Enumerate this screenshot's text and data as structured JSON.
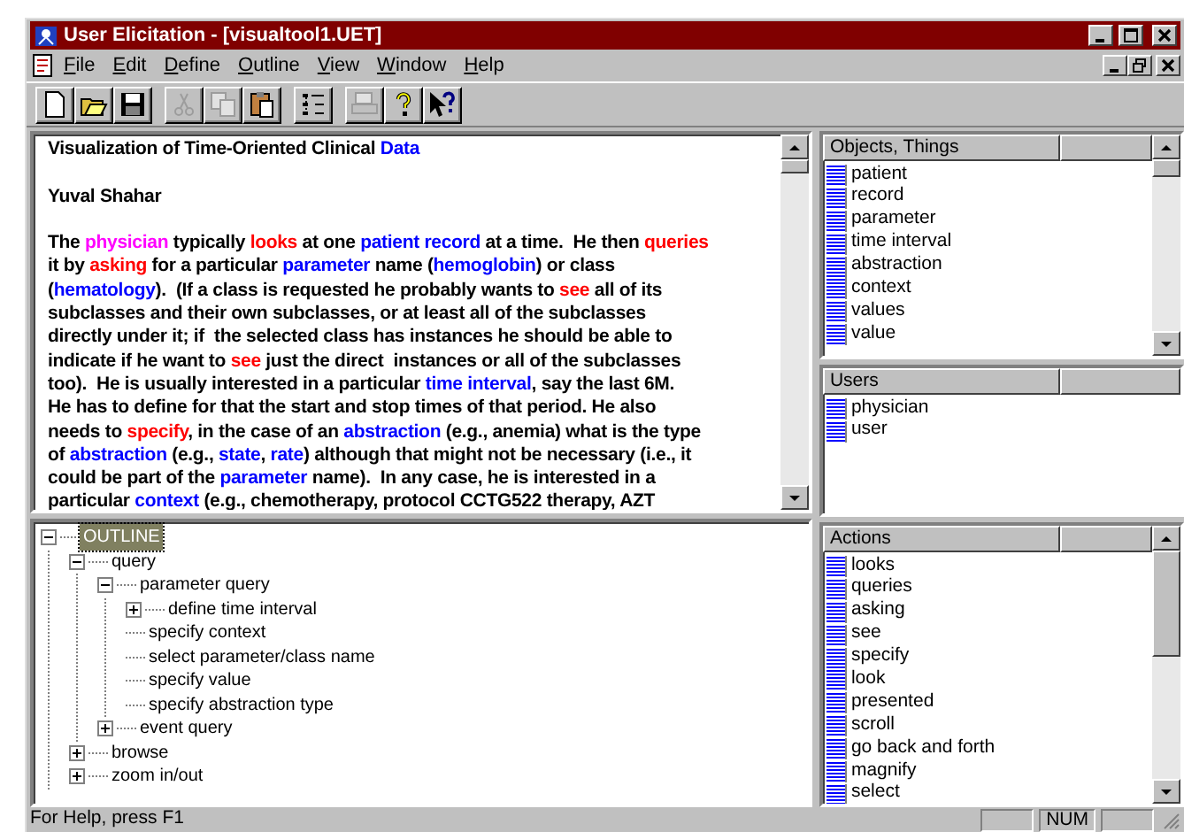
{
  "window": {
    "title": "User Elicitation - [visualtool1.UET]"
  },
  "menu": [
    "File",
    "Edit",
    "Define",
    "Outline",
    "View",
    "Window",
    "Help"
  ],
  "toolbar": [
    {
      "kind": "new",
      "disabled": false
    },
    {
      "kind": "open",
      "disabled": false
    },
    {
      "kind": "save",
      "disabled": false
    },
    {
      "kind": "sep"
    },
    {
      "kind": "cut",
      "disabled": true
    },
    {
      "kind": "copy",
      "disabled": true
    },
    {
      "kind": "paste",
      "disabled": false
    },
    {
      "kind": "sep"
    },
    {
      "kind": "outline",
      "disabled": false
    },
    {
      "kind": "sep"
    },
    {
      "kind": "print",
      "disabled": true
    },
    {
      "kind": "help",
      "disabled": false
    },
    {
      "kind": "context-help",
      "disabled": false
    }
  ],
  "document": {
    "title": [
      {
        "text": "Visualization of Time-Oriented Clinical ",
        "kind": "plain"
      },
      {
        "text": "Data",
        "kind": "object"
      }
    ],
    "author": "Yuval Shahar",
    "lines": [
      [
        {
          "text": "The ",
          "kind": "plain"
        },
        {
          "text": "physician",
          "kind": "user"
        },
        {
          "text": " typically ",
          "kind": "plain"
        },
        {
          "text": "looks",
          "kind": "action"
        },
        {
          "text": " at one ",
          "kind": "plain"
        },
        {
          "text": "patient record",
          "kind": "object"
        },
        {
          "text": " at a time.  He then ",
          "kind": "plain"
        },
        {
          "text": "queries",
          "kind": "action"
        }
      ],
      [
        {
          "text": "it by ",
          "kind": "plain"
        },
        {
          "text": "asking",
          "kind": "action"
        },
        {
          "text": " for a particular ",
          "kind": "plain"
        },
        {
          "text": "parameter",
          "kind": "object"
        },
        {
          "text": " name (",
          "kind": "plain"
        },
        {
          "text": "hemoglobin",
          "kind": "object"
        },
        {
          "text": ") or class",
          "kind": "plain"
        }
      ],
      [
        {
          "text": "(",
          "kind": "plain"
        },
        {
          "text": "hematology",
          "kind": "object"
        },
        {
          "text": ").  (If a class is requested he probably wants to ",
          "kind": "plain"
        },
        {
          "text": "see",
          "kind": "action"
        },
        {
          "text": " all of its",
          "kind": "plain"
        }
      ],
      [
        {
          "text": "subclasses and their own subclasses, or at least all of the subclasses",
          "kind": "plain"
        }
      ],
      [
        {
          "text": "directly under it; if  the selected class has instances he should be able to",
          "kind": "plain"
        }
      ],
      [
        {
          "text": "indicate if he want to ",
          "kind": "plain"
        },
        {
          "text": "see",
          "kind": "action"
        },
        {
          "text": " just the direct  instances or all of the subclasses",
          "kind": "plain"
        }
      ],
      [
        {
          "text": "too).  He is usually interested in a particular ",
          "kind": "plain"
        },
        {
          "text": "time interval",
          "kind": "object"
        },
        {
          "text": ", say the last 6M.",
          "kind": "plain"
        }
      ],
      [
        {
          "text": "He has to define for that the start and stop times of that period. He also",
          "kind": "plain"
        }
      ],
      [
        {
          "text": "needs to ",
          "kind": "plain"
        },
        {
          "text": "specify",
          "kind": "action"
        },
        {
          "text": ", in the case of an ",
          "kind": "plain"
        },
        {
          "text": "abstraction",
          "kind": "object"
        },
        {
          "text": " (e.g., anemia) what is the type",
          "kind": "plain"
        }
      ],
      [
        {
          "text": "of ",
          "kind": "plain"
        },
        {
          "text": "abstraction",
          "kind": "object"
        },
        {
          "text": " (e.g., ",
          "kind": "plain"
        },
        {
          "text": "state",
          "kind": "object"
        },
        {
          "text": ", ",
          "kind": "plain"
        },
        {
          "text": "rate",
          "kind": "object"
        },
        {
          "text": ") although that might not be necessary (i.e., it",
          "kind": "plain"
        }
      ],
      [
        {
          "text": "could be part of the ",
          "kind": "plain"
        },
        {
          "text": "parameter",
          "kind": "object"
        },
        {
          "text": " name).  In any case, he is interested in a",
          "kind": "plain"
        }
      ],
      [
        {
          "text": "particular ",
          "kind": "plain"
        },
        {
          "text": "context",
          "kind": "object"
        },
        {
          "text": " (e.g., chemotherapy, protocol CCTG522 therapy, AZT",
          "kind": "plain"
        }
      ]
    ]
  },
  "outline": [
    {
      "label": "OUTLINE",
      "selected": true,
      "expanded": true,
      "children": [
        {
          "label": "query",
          "selected": false,
          "expanded": true,
          "children": [
            {
              "label": "parameter query",
              "selected": false,
              "expanded": true,
              "children": [
                {
                  "label": "define time interval",
                  "selected": false,
                  "expanded": false
                },
                {
                  "label": "specify context",
                  "selected": false
                },
                {
                  "label": "select parameter/class name",
                  "selected": false
                },
                {
                  "label": "specify value",
                  "selected": false
                },
                {
                  "label": "specify abstraction type",
                  "selected": false
                }
              ]
            },
            {
              "label": "event query",
              "selected": false,
              "expanded": false
            }
          ]
        },
        {
          "label": "browse",
          "selected": false,
          "expanded": false
        },
        {
          "label": "zoom in/out",
          "selected": false,
          "expanded": false
        }
      ]
    }
  ],
  "lists": [
    {
      "heading": "Objects, Things",
      "items": [
        "patient",
        "record",
        "parameter",
        "time interval",
        "abstraction",
        "context",
        "values",
        "value"
      ]
    },
    {
      "heading": "Users",
      "items": [
        "physician",
        "user"
      ]
    },
    {
      "heading": "Actions",
      "items": [
        "looks",
        "queries",
        "asking",
        "see",
        "specify",
        "look",
        "presented",
        "scroll",
        "go back and forth",
        "magnify",
        "select"
      ]
    }
  ],
  "status_bar": {
    "message": "For Help, press F1",
    "panels": [
      {
        "kind": "blank"
      },
      {
        "kind": "indicator",
        "text": "NUM"
      },
      {
        "kind": "blank"
      }
    ]
  }
}
